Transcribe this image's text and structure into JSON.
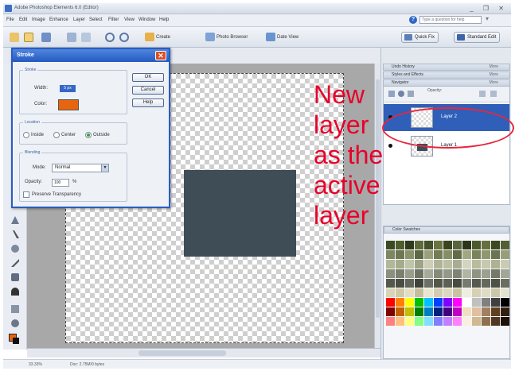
{
  "window": {
    "title": "Adobe Photoshop Elements 6.0 (Editor)",
    "controls": "_ ❐ ✕"
  },
  "menu": [
    "File",
    "Edit",
    "Image",
    "Enhance",
    "Layer",
    "Select",
    "Filter",
    "View",
    "Window",
    "Help"
  ],
  "help_search": {
    "placeholder": "Type a question for help",
    "expander": "▾"
  },
  "toolbar": {
    "create": "Create",
    "photo_browser": "Photo Browser",
    "date_view": "Date View",
    "quick_fix": "Quick Fix",
    "standard_edit": "Standard Edit"
  },
  "dialog": {
    "title": "Stroke",
    "close": "✕",
    "stroke_group": "Stroke",
    "width_label": "Width:",
    "width_value": "5 px",
    "color_label": "Color:",
    "color": "#e8650f",
    "location_group": "Location",
    "location_options": [
      "Inside",
      "Center",
      "Outside"
    ],
    "location_selected": "Outside",
    "blending_group": "Blending",
    "mode_label": "Mode:",
    "mode_value": "Normal",
    "opacity_label": "Opacity:",
    "opacity_value": "100",
    "opacity_unit": "%",
    "preserve_transparency": "Preserve Transparency",
    "ok": "OK",
    "cancel": "Cancel",
    "help": "Help"
  },
  "palette_bin": {
    "panels": [
      "Undo History",
      "Styles and Effects",
      "Navigator"
    ],
    "panel_tag": "More",
    "layers_label": "Opacity:",
    "layers": [
      {
        "name": "Layer 2",
        "active": true
      },
      {
        "name": "Layer 1",
        "active": false
      }
    ],
    "swatches_title": "Color Swatches",
    "swatches": [
      "#3b4a22",
      "#4f5e2d",
      "#2f3b1c",
      "#5f6a3a",
      "#44502a",
      "#6a7440",
      "#3a4520",
      "#59653a",
      "#2c3519",
      "#4d5a2c",
      "#66703f",
      "#3d4923",
      "#535f33",
      "#7d8660",
      "#6e7752",
      "#8a926a",
      "#5e6845",
      "#9aa07a",
      "#737c55",
      "#858d66",
      "#626b47",
      "#a1a782",
      "#7a835c",
      "#8f976f",
      "#6b7450",
      "#979e78",
      "#b3b79a",
      "#a6ab8c",
      "#c0c4a8",
      "#9ea386",
      "#ccceb6",
      "#b0b496",
      "#bcc0a2",
      "#a9ad90",
      "#d3d5c0",
      "#b8bb9d",
      "#c6c9ae",
      "#aeb293",
      "#c9ccb2",
      "#8a8f7e",
      "#7b806e",
      "#999e8c",
      "#6f7462",
      "#a6aa98",
      "#868a78",
      "#93988a",
      "#7f8472",
      "#b1b5a4",
      "#8e9382",
      "#9ca091",
      "#757a68",
      "#a2a696",
      "#55594c",
      "#4a4e42",
      "#61655a",
      "#3f4338",
      "#6c7064",
      "#535748",
      "#5d6153",
      "#484c40",
      "#777b6f",
      "#575b4f",
      "#65695c",
      "#4e5246",
      "#6a6e61",
      "#d9d4b8",
      "#cfc9a8",
      "#e2ddc4",
      "#c4be9c",
      "#e9e5cf",
      "#d2cdb1",
      "#dcd8bf",
      "#c9c3a3",
      "#efece0",
      "#d6d1b5",
      "#e0dcc6",
      "#cdc7a9",
      "#e5e2d0",
      "#ff0000",
      "#ff8000",
      "#ffff00",
      "#00c000",
      "#00c0ff",
      "#0040ff",
      "#8000ff",
      "#ff00ff",
      "#ffffff",
      "#c0c0c0",
      "#808080",
      "#404040",
      "#000000",
      "#800000",
      "#c06000",
      "#c0c000",
      "#008000",
      "#0080c0",
      "#002080",
      "#400080",
      "#c000c0",
      "#f0e0c0",
      "#e0c0a0",
      "#a08060",
      "#604020",
      "#302010",
      "#ff8080",
      "#ffc080",
      "#ffff80",
      "#80ff80",
      "#80e0ff",
      "#8080ff",
      "#c080ff",
      "#ff80ff",
      "#f8f0e0",
      "#d0b890",
      "#907050",
      "#503820",
      "#201008"
    ]
  },
  "annotation": {
    "text": "New layer\nas the\nactive\nlayer",
    "color": "#e8002a"
  },
  "status": {
    "zoom": "33.33%",
    "doc": "Doc: 2.75M/0 bytes"
  }
}
